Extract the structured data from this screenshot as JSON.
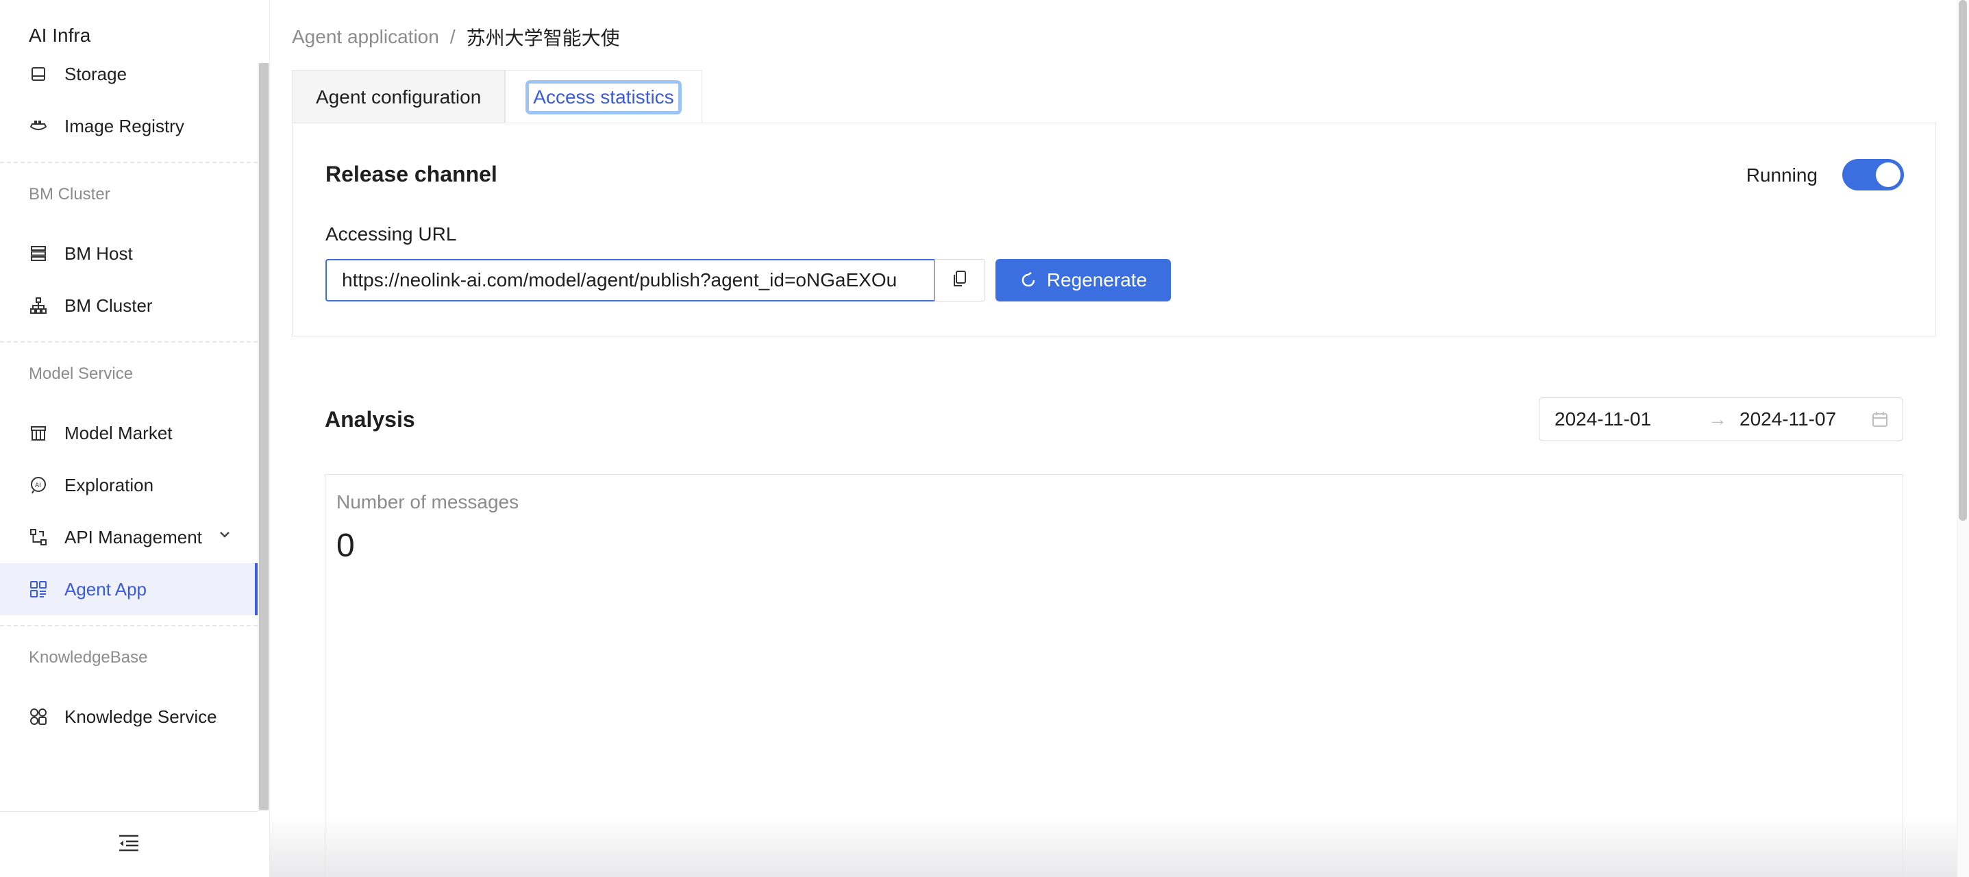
{
  "app": {
    "brand": "AI Infra"
  },
  "sidebar": {
    "items_top": [
      {
        "label": "Storage",
        "icon": "storage-icon"
      },
      {
        "label": "Image Registry",
        "icon": "image-registry-icon"
      }
    ],
    "groups": [
      {
        "title": "BM Cluster",
        "items": [
          {
            "label": "BM Host",
            "icon": "server-icon"
          },
          {
            "label": "BM Cluster",
            "icon": "cluster-icon"
          }
        ]
      },
      {
        "title": "Model Service",
        "items": [
          {
            "label": "Model Market",
            "icon": "market-icon"
          },
          {
            "label": "Exploration",
            "icon": "ai-exploration-icon"
          },
          {
            "label": "API Management",
            "icon": "api-icon"
          },
          {
            "label": "Agent App",
            "icon": "agent-app-icon",
            "active": true
          }
        ]
      },
      {
        "title": "KnowledgeBase",
        "items": [
          {
            "label": "Knowledge Service",
            "icon": "knowledge-icon"
          }
        ]
      }
    ]
  },
  "breadcrumb": {
    "parent": "Agent application",
    "separator": "/",
    "current": "苏州大学智能大使"
  },
  "tabs": [
    {
      "label": "Agent configuration"
    },
    {
      "label": "Access statistics",
      "active": true
    }
  ],
  "release": {
    "title": "Release channel",
    "status_label": "Running",
    "status_on": true,
    "url_label": "Accessing URL",
    "url_value": "https://neolink-ai.com/model/agent/publish?agent_id=oNGaEXOu",
    "regenerate_label": "Regenerate"
  },
  "analysis": {
    "title": "Analysis",
    "date_start": "2024-11-01",
    "date_end": "2024-11-07",
    "stat_label": "Number of messages",
    "stat_value": "0"
  },
  "colors": {
    "accent": "#3b6fe0",
    "active_nav": "#3b5bdb"
  }
}
